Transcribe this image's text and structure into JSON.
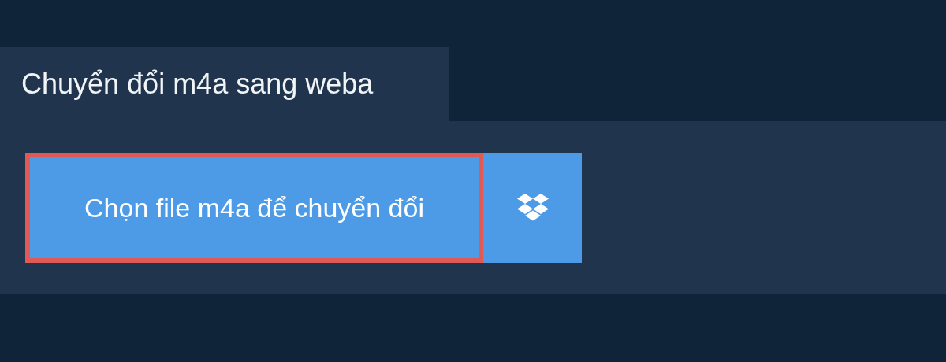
{
  "tab": {
    "title": "Chuyển đổi m4a sang weba"
  },
  "upload_button": {
    "label": "Chọn file m4a để chuyển đổi",
    "focused": true
  },
  "cloud_button": {
    "kind": "dropbox"
  }
}
